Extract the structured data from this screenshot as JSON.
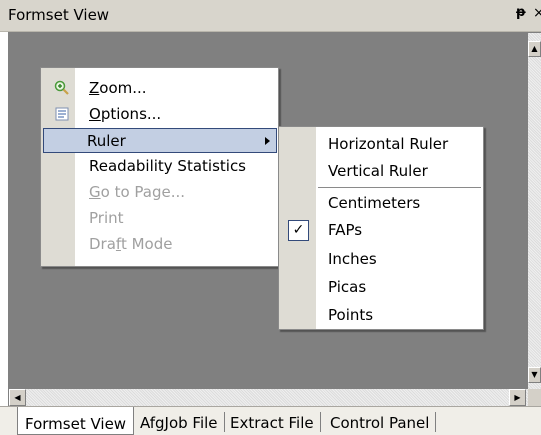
{
  "panel": {
    "title": "Formset View",
    "pin_glyph": "ᵽ",
    "close_glyph": "×"
  },
  "context_menu": {
    "items": [
      {
        "label_prefix": "",
        "underline": "Z",
        "label_rest": "oom...",
        "icon": "zoom-icon",
        "enabled": true
      },
      {
        "label_prefix": "",
        "underline": "O",
        "label_rest": "ptions...",
        "icon": "options-icon",
        "enabled": true
      },
      {
        "label": "Ruler",
        "has_submenu": true,
        "highlighted": true,
        "enabled": true
      },
      {
        "label": "Readability Statistics",
        "enabled": true
      },
      {
        "label_prefix": "",
        "underline": "G",
        "label_rest": "o to Page...",
        "enabled": false
      },
      {
        "label": "Print",
        "enabled": false
      },
      {
        "label_prefix": "Dra",
        "underline": "f",
        "label_rest": "t Mode",
        "enabled": false
      }
    ]
  },
  "ruler_submenu": {
    "items": [
      {
        "label": "Horizontal Ruler",
        "checked": false
      },
      {
        "label": "Vertical Ruler",
        "checked": false
      },
      {
        "label": "Centimeters",
        "checked": false
      },
      {
        "label": "FAPs",
        "checked": true
      },
      {
        "label": "Inches",
        "checked": false
      },
      {
        "label": "Picas",
        "checked": false
      },
      {
        "label": "Points",
        "checked": false
      }
    ],
    "check_glyph": "✓"
  },
  "tabs": [
    {
      "label": "Formset View",
      "active": true
    },
    {
      "label": "AfgJob File",
      "active": false
    },
    {
      "label": "Extract File",
      "active": false
    },
    {
      "label": "Control Panel",
      "active": false
    }
  ],
  "scroll_glyphs": {
    "up": "▲",
    "down": "▼",
    "left": "◀",
    "right": "▶"
  }
}
